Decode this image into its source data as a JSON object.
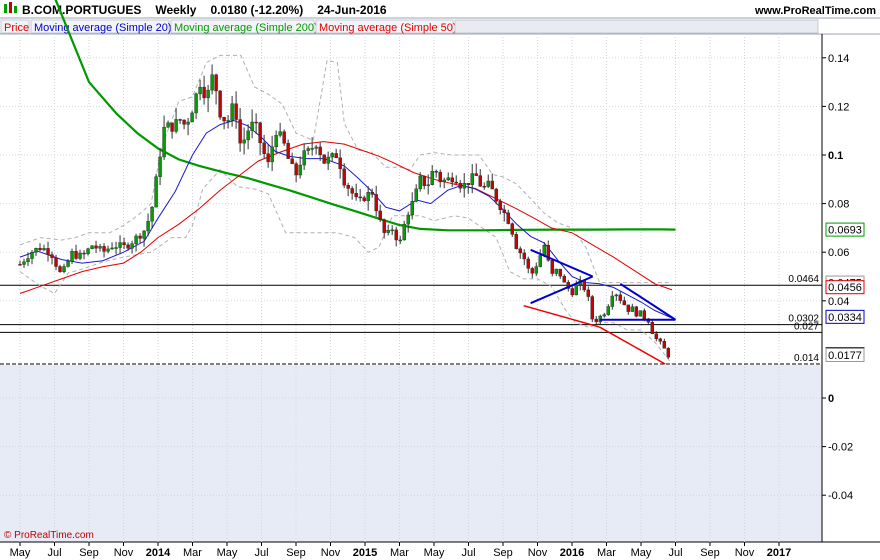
{
  "header": {
    "symbol": "B.COM.PORTUGUES",
    "period": "Weekly",
    "last": "0.0180 (-12.20%)",
    "date": "24-Jun-2016",
    "site": "www.ProRealTime.com"
  },
  "legend": [
    {
      "label": "Price",
      "color": "#e00000"
    },
    {
      "label": "Moving average (Simple 20)",
      "color": "#0000cc"
    },
    {
      "label": "Moving average (Simple 200)",
      "color": "#009900"
    },
    {
      "label": "Moving average (Simple 50)",
      "color": "#e00000"
    }
  ],
  "footer": "© ProRealTime.com",
  "colors": {
    "up": "#00a000",
    "down": "#cc0000",
    "ma20": "#1a1ad0",
    "ma50": "#e00000",
    "ma200": "#009900",
    "band": "#b0b0b0",
    "trend_blue": "#0000cc",
    "trend_red": "#ee0000"
  },
  "chart_data": {
    "type": "candlestick",
    "x_labels": [
      "May",
      "Jul",
      "Sep",
      "Nov",
      "2014",
      "Mar",
      "May",
      "Jul",
      "Sep",
      "Nov",
      "2015",
      "Mar",
      "May",
      "Jul",
      "Sep",
      "Nov",
      "2016",
      "Mar",
      "May",
      "Jul",
      "Sep",
      "Nov",
      "2017"
    ],
    "x_bold": [
      4,
      10,
      16,
      22
    ],
    "y_ticks": [
      {
        "v": 0.14,
        "label": "0.14"
      },
      {
        "v": 0.12,
        "label": "0.12"
      },
      {
        "v": 0.1,
        "label": "0.1",
        "bold": true
      },
      {
        "v": 0.08,
        "label": "0.08"
      },
      {
        "v": 0.06,
        "label": "0.06"
      },
      {
        "v": 0.04,
        "label": "0.04"
      },
      {
        "v": 0,
        "label": "0",
        "bold": true
      },
      {
        "v": -0.02,
        "label": "-0.02"
      },
      {
        "v": -0.04,
        "label": "-0.04"
      }
    ],
    "y_range": [
      -0.055,
      0.152
    ],
    "level_lines": [
      {
        "v": 0.0464,
        "label": "0.0464",
        "style": "solid"
      },
      {
        "v": 0.0302,
        "label": "0.0302",
        "style": "solid"
      },
      {
        "v": 0.027,
        "label": "0.027",
        "style": "solid"
      },
      {
        "v": 0.014,
        "label": "0.014",
        "style": "dashed"
      }
    ],
    "price_tags": [
      {
        "v": 0.0693,
        "label": "0.0693",
        "color": "#009900",
        "fill": "#ffffff"
      },
      {
        "v": 0.0475,
        "label": "0.0475",
        "color": "#999999",
        "fill": "#ffffff"
      },
      {
        "v": 0.0456,
        "label": "0.0456",
        "color": "#e00000",
        "fill": "#ffffff"
      },
      {
        "v": 0.0334,
        "label": "0.0334",
        "color": "#0000cc",
        "fill": "#ffffff"
      },
      {
        "v": 0.018,
        "label": "0.0180",
        "color": "#000000",
        "fill": "#ffff00"
      },
      {
        "v": 0.0177,
        "label": "0.0177",
        "color": "#999999",
        "fill": "#ffffff"
      }
    ],
    "ma200": [
      [
        0.0,
        0.2
      ],
      [
        2.0,
        0.13
      ],
      [
        2.8,
        0.117
      ],
      [
        3.4,
        0.109
      ],
      [
        4.0,
        0.1027
      ],
      [
        4.6,
        0.0982
      ],
      [
        5.2,
        0.0955
      ],
      [
        6.0,
        0.0925
      ],
      [
        6.6,
        0.0905
      ],
      [
        7.2,
        0.088
      ],
      [
        7.8,
        0.0855
      ],
      [
        8.4,
        0.0828
      ],
      [
        9.0,
        0.08
      ],
      [
        9.8,
        0.0765
      ],
      [
        10.4,
        0.0738
      ],
      [
        11.0,
        0.0712
      ],
      [
        11.6,
        0.0696
      ],
      [
        12.4,
        0.069
      ],
      [
        13.4,
        0.069
      ],
      [
        14.6,
        0.0692
      ],
      [
        15.6,
        0.0693
      ],
      [
        16.6,
        0.0693
      ],
      [
        17.6,
        0.0694
      ],
      [
        18.6,
        0.0694
      ],
      [
        19.0,
        0.0693
      ]
    ],
    "ma50": [
      [
        0.0,
        0.043
      ],
      [
        0.6,
        0.046
      ],
      [
        1.2,
        0.049
      ],
      [
        1.8,
        0.052
      ],
      [
        2.4,
        0.054
      ],
      [
        3.0,
        0.0555
      ],
      [
        3.5,
        0.06
      ],
      [
        4.0,
        0.066
      ],
      [
        4.6,
        0.0715
      ],
      [
        5.2,
        0.078
      ],
      [
        5.8,
        0.0855
      ],
      [
        6.4,
        0.092
      ],
      [
        6.9,
        0.0975
      ],
      [
        7.5,
        0.101
      ],
      [
        8.2,
        0.1045
      ],
      [
        8.8,
        0.1055
      ],
      [
        9.4,
        0.1045
      ],
      [
        9.9,
        0.102
      ],
      [
        10.4,
        0.0995
      ],
      [
        10.8,
        0.097
      ],
      [
        11.4,
        0.0928
      ],
      [
        12.0,
        0.09
      ],
      [
        12.6,
        0.088
      ],
      [
        13.2,
        0.0862
      ],
      [
        13.8,
        0.082
      ],
      [
        14.4,
        0.0778
      ],
      [
        14.9,
        0.074
      ],
      [
        15.4,
        0.07
      ],
      [
        16.0,
        0.068
      ],
      [
        16.6,
        0.063
      ],
      [
        17.2,
        0.058
      ],
      [
        17.8,
        0.0525
      ],
      [
        18.4,
        0.047
      ],
      [
        18.9,
        0.0445
      ]
    ],
    "ma20": [
      [
        0.0,
        0.058
      ],
      [
        0.5,
        0.0605
      ],
      [
        1.2,
        0.057
      ],
      [
        1.8,
        0.0555
      ],
      [
        2.4,
        0.0565
      ],
      [
        3.0,
        0.06
      ],
      [
        3.6,
        0.0645
      ],
      [
        4.0,
        0.074
      ],
      [
        4.5,
        0.085
      ],
      [
        5.0,
        0.1
      ],
      [
        5.4,
        0.109
      ],
      [
        5.8,
        0.1125
      ],
      [
        6.2,
        0.1142
      ],
      [
        6.6,
        0.112
      ],
      [
        7.0,
        0.1072
      ],
      [
        7.4,
        0.1015
      ],
      [
        7.8,
        0.0995
      ],
      [
        8.3,
        0.0985
      ],
      [
        8.8,
        0.0985
      ],
      [
        9.4,
        0.0955
      ],
      [
        9.8,
        0.0905
      ],
      [
        10.2,
        0.085
      ],
      [
        10.6,
        0.0785
      ],
      [
        11.0,
        0.077
      ],
      [
        11.5,
        0.0815
      ],
      [
        11.9,
        0.08
      ],
      [
        12.4,
        0.0855
      ],
      [
        12.8,
        0.0875
      ],
      [
        13.2,
        0.086
      ],
      [
        13.6,
        0.083
      ],
      [
        14.0,
        0.0775
      ],
      [
        14.4,
        0.0715
      ],
      [
        14.8,
        0.0665
      ],
      [
        15.2,
        0.0638
      ],
      [
        15.6,
        0.0565
      ],
      [
        16.0,
        0.05
      ],
      [
        16.4,
        0.0475
      ],
      [
        16.8,
        0.047
      ],
      [
        17.2,
        0.0455
      ],
      [
        17.6,
        0.0425
      ],
      [
        18.0,
        0.0395
      ],
      [
        18.4,
        0.036
      ],
      [
        18.9,
        0.0329
      ]
    ],
    "band_upper": [
      [
        0.0,
        0.063
      ],
      [
        0.6,
        0.066
      ],
      [
        1.2,
        0.065
      ],
      [
        1.6,
        0.066
      ],
      [
        2.0,
        0.068
      ],
      [
        2.6,
        0.068
      ],
      [
        3.0,
        0.071
      ],
      [
        3.4,
        0.075
      ],
      [
        3.8,
        0.08
      ],
      [
        4.1,
        0.103
      ],
      [
        4.6,
        0.122
      ],
      [
        5.0,
        0.124
      ],
      [
        5.4,
        0.138
      ],
      [
        5.8,
        0.141
      ],
      [
        6.4,
        0.141
      ],
      [
        6.8,
        0.128
      ],
      [
        7.2,
        0.125
      ],
      [
        7.6,
        0.121
      ],
      [
        8.0,
        0.109
      ],
      [
        8.5,
        0.106
      ],
      [
        8.9,
        0.139
      ],
      [
        9.2,
        0.138
      ],
      [
        9.4,
        0.113
      ],
      [
        9.8,
        0.102
      ],
      [
        10.2,
        0.101
      ],
      [
        10.6,
        0.095
      ],
      [
        11.0,
        0.095
      ],
      [
        11.3,
        0.094
      ],
      [
        11.6,
        0.1
      ],
      [
        12.0,
        0.101
      ],
      [
        12.5,
        0.1
      ],
      [
        12.9,
        0.1
      ],
      [
        13.3,
        0.1
      ],
      [
        13.7,
        0.092
      ],
      [
        14.0,
        0.091
      ],
      [
        14.4,
        0.088
      ],
      [
        14.8,
        0.082
      ],
      [
        15.2,
        0.076
      ],
      [
        15.6,
        0.072
      ],
      [
        16.0,
        0.07
      ],
      [
        16.4,
        0.062
      ],
      [
        16.8,
        0.0475
      ],
      [
        17.2,
        0.0475
      ],
      [
        17.6,
        0.0475
      ],
      [
        18.4,
        0.0475
      ],
      [
        18.9,
        0.0475
      ]
    ],
    "band_lower": [
      [
        0.0,
        0.052
      ],
      [
        0.6,
        0.046
      ],
      [
        1.0,
        0.043
      ],
      [
        1.4,
        0.0515
      ],
      [
        1.8,
        0.053
      ],
      [
        2.4,
        0.056
      ],
      [
        3.0,
        0.058
      ],
      [
        3.4,
        0.059
      ],
      [
        3.8,
        0.06
      ],
      [
        4.0,
        0.062
      ],
      [
        4.4,
        0.066
      ],
      [
        4.8,
        0.066
      ],
      [
        5.0,
        0.071
      ],
      [
        5.3,
        0.086
      ],
      [
        5.8,
        0.094
      ],
      [
        6.3,
        0.087
      ],
      [
        6.8,
        0.086
      ],
      [
        7.2,
        0.084
      ],
      [
        7.7,
        0.068
      ],
      [
        8.2,
        0.068
      ],
      [
        8.8,
        0.068
      ],
      [
        9.2,
        0.068
      ],
      [
        9.7,
        0.066
      ],
      [
        10.1,
        0.06
      ],
      [
        10.4,
        0.062
      ],
      [
        10.8,
        0.075
      ],
      [
        11.2,
        0.075
      ],
      [
        11.6,
        0.075
      ],
      [
        12.0,
        0.073
      ],
      [
        12.6,
        0.075
      ],
      [
        13.0,
        0.074
      ],
      [
        13.4,
        0.07
      ],
      [
        13.8,
        0.066
      ],
      [
        14.2,
        0.052
      ],
      [
        14.6,
        0.049
      ],
      [
        15.0,
        0.049
      ],
      [
        15.4,
        0.046
      ],
      [
        15.8,
        0.0365
      ],
      [
        16.1,
        0.031
      ],
      [
        16.5,
        0.029
      ],
      [
        16.8,
        0.031
      ],
      [
        17.2,
        0.031
      ],
      [
        17.6,
        0.028
      ],
      [
        18.0,
        0.028
      ],
      [
        18.4,
        0.023
      ],
      [
        18.9,
        0.014
      ]
    ],
    "close_path": [
      [
        0.0,
        0.055
      ],
      [
        0.3,
        0.06
      ],
      [
        0.6,
        0.062
      ],
      [
        0.9,
        0.06
      ],
      [
        1.2,
        0.05
      ],
      [
        1.5,
        0.0595
      ],
      [
        1.8,
        0.058
      ],
      [
        2.1,
        0.063
      ],
      [
        2.4,
        0.06
      ],
      [
        2.7,
        0.063
      ],
      [
        3.0,
        0.062
      ],
      [
        3.3,
        0.065
      ],
      [
        3.6,
        0.069
      ],
      [
        3.8,
        0.076
      ],
      [
        4.0,
        0.095
      ],
      [
        4.2,
        0.113
      ],
      [
        4.4,
        0.111
      ],
      [
        4.6,
        0.115
      ],
      [
        4.8,
        0.112
      ],
      [
        5.0,
        0.119
      ],
      [
        5.2,
        0.13
      ],
      [
        5.4,
        0.123
      ],
      [
        5.6,
        0.134
      ],
      [
        5.8,
        0.117
      ],
      [
        6.0,
        0.113
      ],
      [
        6.2,
        0.122
      ],
      [
        6.4,
        0.103
      ],
      [
        6.6,
        0.11
      ],
      [
        6.8,
        0.114
      ],
      [
        7.0,
        0.103
      ],
      [
        7.2,
        0.096
      ],
      [
        7.4,
        0.11
      ],
      [
        7.6,
        0.107
      ],
      [
        7.8,
        0.097
      ],
      [
        8.0,
        0.092
      ],
      [
        8.2,
        0.1
      ],
      [
        8.4,
        0.102
      ],
      [
        8.6,
        0.105
      ],
      [
        8.8,
        0.097
      ],
      [
        9.0,
        0.099
      ],
      [
        9.2,
        0.1
      ],
      [
        9.4,
        0.089
      ],
      [
        9.6,
        0.085
      ],
      [
        9.8,
        0.08
      ],
      [
        10.0,
        0.083
      ],
      [
        10.2,
        0.085
      ],
      [
        10.4,
        0.074
      ],
      [
        10.6,
        0.066
      ],
      [
        10.8,
        0.07
      ],
      [
        11.0,
        0.063
      ],
      [
        11.2,
        0.075
      ],
      [
        11.4,
        0.081
      ],
      [
        11.6,
        0.09
      ],
      [
        11.8,
        0.087
      ],
      [
        12.0,
        0.095
      ],
      [
        12.2,
        0.089
      ],
      [
        12.4,
        0.09
      ],
      [
        12.6,
        0.091
      ],
      [
        12.8,
        0.087
      ],
      [
        13.0,
        0.089
      ],
      [
        13.2,
        0.092
      ],
      [
        13.4,
        0.086
      ],
      [
        13.6,
        0.088
      ],
      [
        13.8,
        0.082
      ],
      [
        14.0,
        0.077
      ],
      [
        14.2,
        0.072
      ],
      [
        14.4,
        0.062
      ],
      [
        14.6,
        0.058
      ],
      [
        14.8,
        0.05
      ],
      [
        15.0,
        0.056
      ],
      [
        15.2,
        0.063
      ],
      [
        15.4,
        0.05
      ],
      [
        15.6,
        0.053
      ],
      [
        15.8,
        0.046
      ],
      [
        16.0,
        0.044
      ],
      [
        16.2,
        0.047
      ],
      [
        16.4,
        0.045
      ],
      [
        16.6,
        0.032
      ],
      [
        16.8,
        0.033
      ],
      [
        17.0,
        0.037
      ],
      [
        17.2,
        0.045
      ],
      [
        17.4,
        0.041
      ],
      [
        17.6,
        0.037
      ],
      [
        17.8,
        0.036
      ],
      [
        18.0,
        0.034
      ],
      [
        18.2,
        0.033
      ],
      [
        18.4,
        0.025
      ],
      [
        18.6,
        0.021
      ],
      [
        18.8,
        0.018
      ]
    ],
    "trendlines_blue": [
      [
        [
          14.8,
          0.061
        ],
        [
          16.6,
          0.05
        ]
      ],
      [
        [
          14.8,
          0.039
        ],
        [
          16.6,
          0.05
        ]
      ],
      [
        [
          17.4,
          0.047
        ],
        [
          19.0,
          0.0322
        ]
      ],
      [
        [
          16.8,
          0.0322
        ],
        [
          19.0,
          0.0322
        ]
      ]
    ],
    "trendlines_red": [
      [
        [
          14.6,
          0.038
        ],
        [
          16.8,
          0.0292
        ]
      ],
      [
        [
          16.8,
          0.0292
        ],
        [
          18.7,
          0.014
        ]
      ]
    ]
  }
}
